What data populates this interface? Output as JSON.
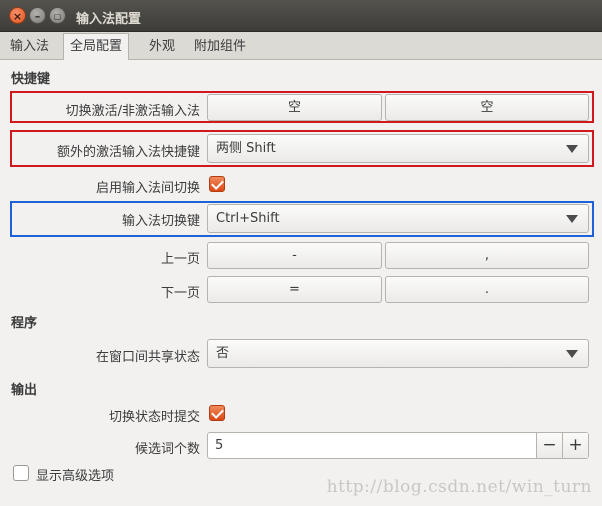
{
  "window": {
    "title": "输入法配置",
    "close": "×",
    "minimize": "–",
    "maximize": "▢"
  },
  "tabs": [
    {
      "label": "输入法"
    },
    {
      "label": "全局配置"
    },
    {
      "label": "外观"
    },
    {
      "label": "附加组件"
    }
  ],
  "sections": {
    "hotkeys": "快捷键",
    "program": "程序",
    "output": "输出"
  },
  "rows": {
    "toggle_ime": {
      "label": "切换激活/非激活输入法",
      "key1": "空",
      "key2": "空"
    },
    "extra_ime": {
      "label": "额外的激活输入法快捷键",
      "value": "两侧 Shift"
    },
    "enable_switch": {
      "label": "启用输入法间切换",
      "checked": true
    },
    "switch_key": {
      "label": "输入法切换键",
      "value": "Ctrl+Shift"
    },
    "prev_page": {
      "label": "上一页",
      "key1": "-",
      "key2": ","
    },
    "next_page": {
      "label": "下一页",
      "key1": "=",
      "key2": "."
    },
    "share_state": {
      "label": "在窗口间共享状态",
      "value": "否"
    },
    "commit_on_switch": {
      "label": "切换状态时提交",
      "checked": true
    },
    "candidates": {
      "label": "候选词个数",
      "value": "5",
      "minus": "−",
      "plus": "+"
    },
    "advanced": {
      "label": "显示高级选项",
      "checked": false
    }
  },
  "watermark": "http://blog.csdn.net/win_turn",
  "colors": {
    "accent": "#dd4814",
    "highlight_red": "#d0181d",
    "highlight_blue": "#1b63d6"
  }
}
